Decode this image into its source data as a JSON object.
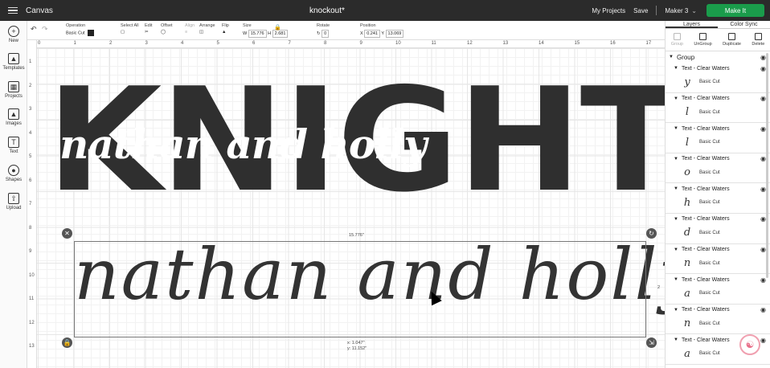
{
  "topbar": {
    "app_name": "Canvas",
    "doc_title": "knockout*",
    "my_projects": "My Projects",
    "save": "Save",
    "machine": "Maker 3",
    "make_it": "Make It"
  },
  "nav": [
    {
      "label": "New",
      "icon": "plus-icon"
    },
    {
      "label": "Templates",
      "icon": "shirt-icon"
    },
    {
      "label": "Projects",
      "icon": "folder-icon"
    },
    {
      "label": "Images",
      "icon": "image-icon"
    },
    {
      "label": "Text",
      "icon": "text-icon"
    },
    {
      "label": "Shapes",
      "icon": "shapes-icon"
    },
    {
      "label": "Upload",
      "icon": "upload-icon"
    }
  ],
  "toolbar": {
    "operation_label": "Operation",
    "operation_value": "Basic Cut",
    "select_all_label": "Select All",
    "edit_label": "Edit",
    "offset_label": "Offset",
    "align_label": "Align",
    "arrange_label": "Arrange",
    "flip_label": "Flip",
    "size_label": "Size",
    "w_label": "W",
    "w_value": "15.776",
    "h_label": "H",
    "h_value": "2.681",
    "rotate_label": "Rotate",
    "rotate_value": "0",
    "position_label": "Position",
    "x_label": "X",
    "x_value": "0.241",
    "y_label": "Y",
    "y_value": "13.069"
  },
  "ruler": {
    "top": [
      "0",
      "1",
      "2",
      "3",
      "4",
      "5",
      "6",
      "7",
      "8",
      "9",
      "10",
      "11",
      "12",
      "13",
      "14",
      "15",
      "16",
      "17"
    ],
    "left": [
      "1",
      "2",
      "3",
      "4",
      "5",
      "6",
      "7",
      "8",
      "9",
      "10",
      "11",
      "12",
      "13"
    ]
  },
  "canvas": {
    "main_text": "KNIGHT",
    "knockout_text": "nathan and holly",
    "script_text": "nathan and holly",
    "width_readout": "15.776\"",
    "height_readout": "2",
    "pos_x_readout": "x: 1.047\"",
    "pos_y_readout": "y: 11.152\""
  },
  "rightpanel": {
    "tab_layers": "Layers",
    "tab_color_sync": "Color Sync",
    "actions": [
      {
        "label": "Group",
        "enabled": false
      },
      {
        "label": "UnGroup",
        "enabled": true
      },
      {
        "label": "Duplicate",
        "enabled": true
      },
      {
        "label": "Delete",
        "enabled": true
      }
    ],
    "group_label": "Group",
    "layers": [
      {
        "name": "Text - Clear Waters",
        "glyph": "y",
        "op": "Basic Cut"
      },
      {
        "name": "Text - Clear Waters",
        "glyph": "l",
        "op": "Basic Cut"
      },
      {
        "name": "Text - Clear Waters",
        "glyph": "l",
        "op": "Basic Cut"
      },
      {
        "name": "Text - Clear Waters",
        "glyph": "o",
        "op": "Basic Cut"
      },
      {
        "name": "Text - Clear Waters",
        "glyph": "h",
        "op": "Basic Cut"
      },
      {
        "name": "Text - Clear Waters",
        "glyph": "d",
        "op": "Basic Cut"
      },
      {
        "name": "Text - Clear Waters",
        "glyph": "n",
        "op": "Basic Cut"
      },
      {
        "name": "Text - Clear Waters",
        "glyph": "a",
        "op": "Basic Cut"
      },
      {
        "name": "Text - Clear Waters",
        "glyph": "n",
        "op": "Basic Cut"
      },
      {
        "name": "Text - Clear Waters",
        "glyph": "a",
        "op": "Basic Cut"
      }
    ]
  },
  "colors": {
    "topbar_bg": "#2b2b2b",
    "make_it": "#1a9c4b",
    "text_fill": "#2f2f2f"
  }
}
